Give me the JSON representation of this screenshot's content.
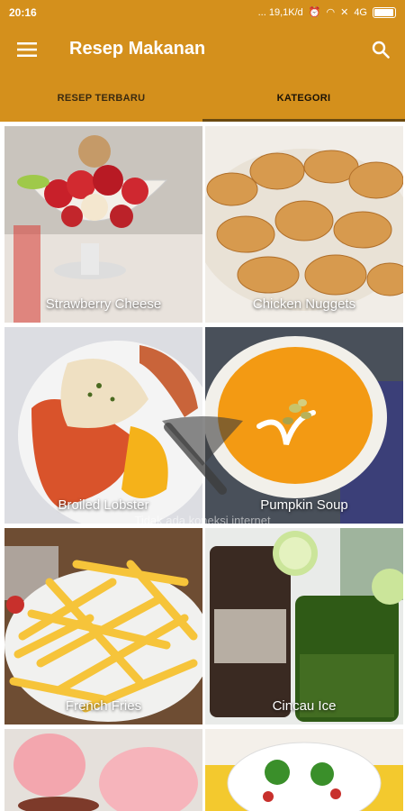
{
  "status": {
    "time": "20:16",
    "network_speed": "... 19,1K/d",
    "signal": "4G"
  },
  "appbar": {
    "title": "Resep Makanan",
    "menu_icon": "hamburger-menu-icon",
    "search_icon": "search-icon"
  },
  "tabs": [
    {
      "label": "RESEP TERBARU",
      "active": false
    },
    {
      "label": "KATEGORI",
      "active": true
    }
  ],
  "recipes": [
    {
      "name": "Strawberry Cheese"
    },
    {
      "name": "Chicken Nuggets"
    },
    {
      "name": "Broiled Lobster"
    },
    {
      "name": "Pumpkin Soup"
    },
    {
      "name": "French Fries"
    },
    {
      "name": "Cincau Ice"
    },
    {
      "name": ""
    },
    {
      "name": ""
    }
  ],
  "offline_message": "Tidak ada koneksi internet",
  "colors": {
    "primary": "#d4901c",
    "tab_indicator": "#6b4a10"
  }
}
